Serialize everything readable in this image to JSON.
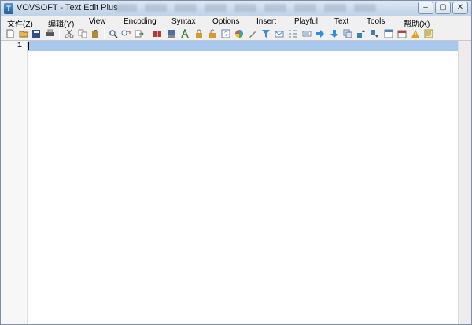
{
  "window": {
    "title": "VOVSOFT - Text Edit Plus",
    "app_icon_glyph": "T"
  },
  "controls": {
    "minimize": "–",
    "maximize": "▢",
    "close": "✕"
  },
  "menubar": {
    "items": [
      {
        "label": "文件(Z)"
      },
      {
        "label": "编辑(Y)"
      },
      {
        "label": "View"
      },
      {
        "label": "Encoding"
      },
      {
        "label": "Syntax"
      },
      {
        "label": "Options"
      },
      {
        "label": "Insert"
      },
      {
        "label": "Playful"
      },
      {
        "label": "Text"
      },
      {
        "label": "Tools"
      },
      {
        "label": "帮助(X)"
      }
    ]
  },
  "toolbar": {
    "buttons": [
      {
        "name": "new-file-icon",
        "color": "#ffffff"
      },
      {
        "name": "open-folder-icon",
        "color": "#e8b64a"
      },
      {
        "name": "save-icon",
        "color": "#2d4e8a"
      },
      {
        "name": "print-icon",
        "color": "#555555"
      },
      {
        "name": "cut-icon",
        "color": "#666666"
      },
      {
        "name": "copy-icon",
        "color": "#8a8a8a"
      },
      {
        "name": "paste-icon",
        "color": "#b08a3a"
      },
      {
        "name": "find-icon",
        "color": "#4a6fa5"
      },
      {
        "name": "replace-icon",
        "color": "#c0392b"
      },
      {
        "name": "goto-icon",
        "color": "#3a7d3a"
      },
      {
        "name": "book-icon",
        "color": "#b03a3a"
      },
      {
        "name": "stamp-icon",
        "color": "#4a6fa5"
      },
      {
        "name": "font-icon",
        "color": "#2e7d32"
      },
      {
        "name": "lock-icon",
        "color": "#d49a2a"
      },
      {
        "name": "unlock-icon",
        "color": "#d49a2a"
      },
      {
        "name": "help-card-icon",
        "color": "#6a7fa5"
      },
      {
        "name": "color-wheel-icon",
        "color": "#e05050"
      },
      {
        "name": "pen-icon",
        "color": "#7a7a7a"
      },
      {
        "name": "filter-icon",
        "color": "#3a8fd0"
      },
      {
        "name": "mail-icon",
        "color": "#5a8ac6"
      },
      {
        "name": "list-icon",
        "color": "#5a7fa5"
      },
      {
        "name": "keyboard-icon",
        "color": "#6a8ab0"
      },
      {
        "name": "arrow-right-icon",
        "color": "#2f8fd8"
      },
      {
        "name": "arrow-down-icon",
        "color": "#2f8fd8"
      },
      {
        "name": "copy-pages-icon",
        "color": "#5a7fa5"
      },
      {
        "name": "sort-up-icon",
        "color": "#3a7fb5"
      },
      {
        "name": "sort-down-icon",
        "color": "#3a7fb5"
      },
      {
        "name": "window-icon",
        "color": "#5a7fa5"
      },
      {
        "name": "calendar-icon",
        "color": "#c03a3a"
      },
      {
        "name": "warning-icon",
        "color": "#e0a020"
      },
      {
        "name": "note-icon",
        "color": "#a08a40"
      }
    ]
  },
  "editor": {
    "line_number": "1",
    "current_line_color": "#a9c6ec"
  }
}
